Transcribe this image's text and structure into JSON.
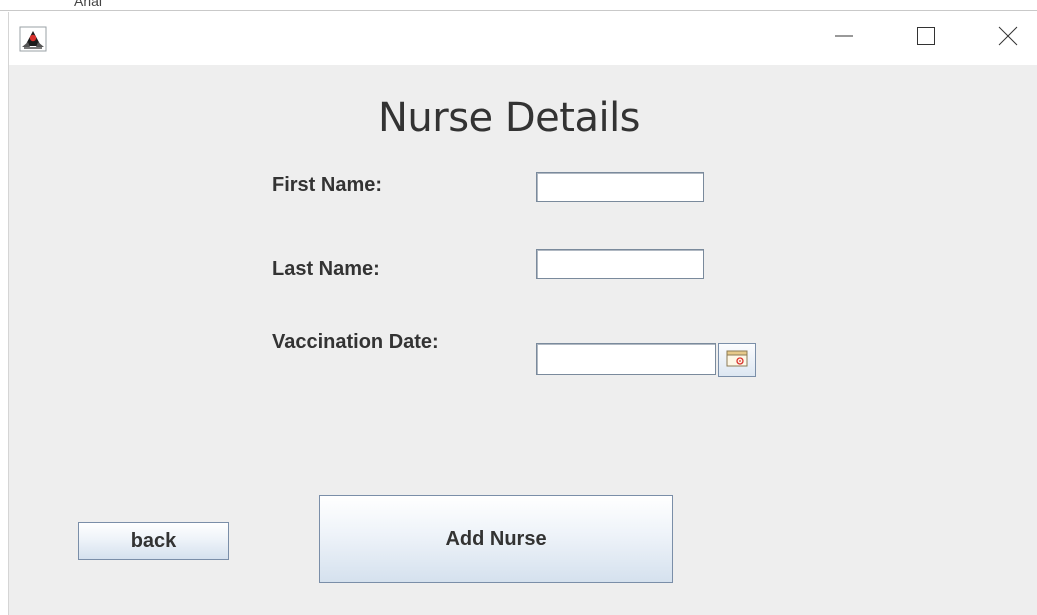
{
  "backdrop": {
    "font_text": "Arial"
  },
  "titlebar": {
    "app_icon": "java-duke-icon",
    "minimize_icon": "minimize-icon",
    "maximize_icon": "maximize-icon",
    "close_icon": "close-icon"
  },
  "form": {
    "title": "Nurse Details",
    "first_name_label": "First Name:",
    "first_name_value": "",
    "last_name_label": "Last Name:",
    "last_name_value": "",
    "vaccination_date_label": "Vaccination Date:",
    "vaccination_date_value": "",
    "calendar_icon": "calendar-icon"
  },
  "buttons": {
    "back_label": "back",
    "add_nurse_label": "Add Nurse"
  }
}
